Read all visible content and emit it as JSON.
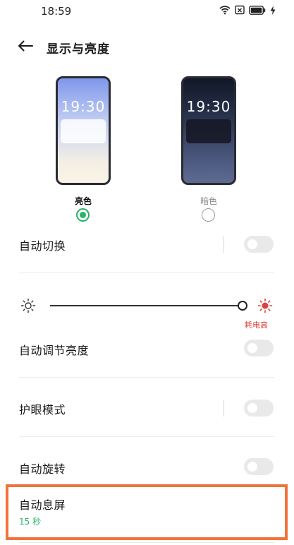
{
  "status_bar": {
    "time": "18:59",
    "icons": [
      "wifi-icon",
      "sim-icon",
      "battery-icon",
      "charging-icon"
    ]
  },
  "header": {
    "back_icon": "arrow-left-icon",
    "title": "显示与亮度"
  },
  "theme": {
    "light": {
      "preview_time": "19:30",
      "label": "亮色",
      "selected": true
    },
    "dark": {
      "preview_time": "19:30",
      "label": "暗色",
      "selected": false
    },
    "accent_color": "#27b36a"
  },
  "settings": {
    "auto_switch": {
      "label": "自动切换",
      "enabled": false
    },
    "brightness": {
      "low_icon": "sun-outline-icon",
      "high_icon": "sun-filled-icon",
      "power_note": "耗电高",
      "level": 1.0,
      "warning_color": "#d9433b"
    },
    "auto_brightness": {
      "label": "自动调节亮度",
      "enabled": false
    },
    "eye_care": {
      "label": "护眼模式",
      "enabled": false
    },
    "auto_rotate": {
      "label": "自动旋转",
      "enabled": false
    },
    "auto_sleep": {
      "label": "自动息屏",
      "value": "15 秒",
      "highlight_color": "#f0733b"
    }
  }
}
